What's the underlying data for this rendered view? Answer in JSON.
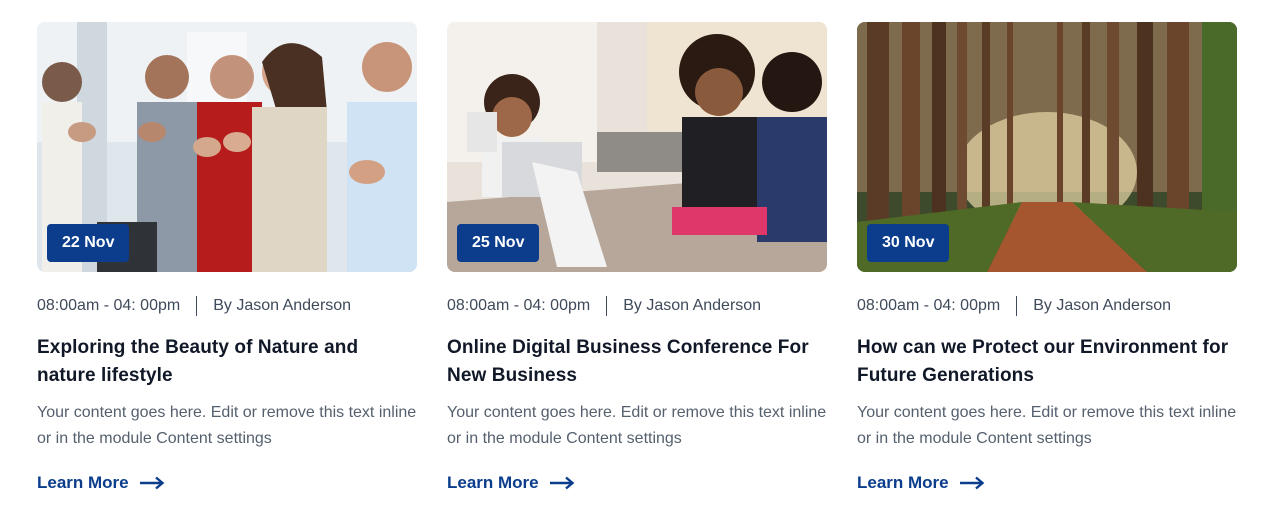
{
  "cards": [
    {
      "date": "22 Nov",
      "time": "08:00am - 04: 00pm",
      "author": "By Jason Anderson",
      "title": "Exploring the Beauty of Nature and nature lifestyle",
      "description": "Your content goes here. Edit or remove this text inline or in the module Content settings",
      "link": "Learn More",
      "image": "people applauding at a conference"
    },
    {
      "date": "25 Nov",
      "time": "08:00am - 04: 00pm",
      "author": "By Jason Anderson",
      "title": "Online Digital Business Conference For New Business",
      "description": "Your content goes here. Edit or remove this text inline or in the module Content settings",
      "link": "Learn More",
      "image": "women in a business meeting"
    },
    {
      "date": "30 Nov",
      "time": "08:00am - 04: 00pm",
      "author": "By Jason Anderson",
      "title": "How can we Protect our Environment for Future Generations",
      "description": "Your content goes here. Edit or remove this text inline or in the module Content settings",
      "link": "Learn More",
      "image": "forest path with tall trees"
    }
  ],
  "colors": {
    "accent": "#0b3d8c",
    "title": "#111827",
    "body": "#55606e"
  }
}
